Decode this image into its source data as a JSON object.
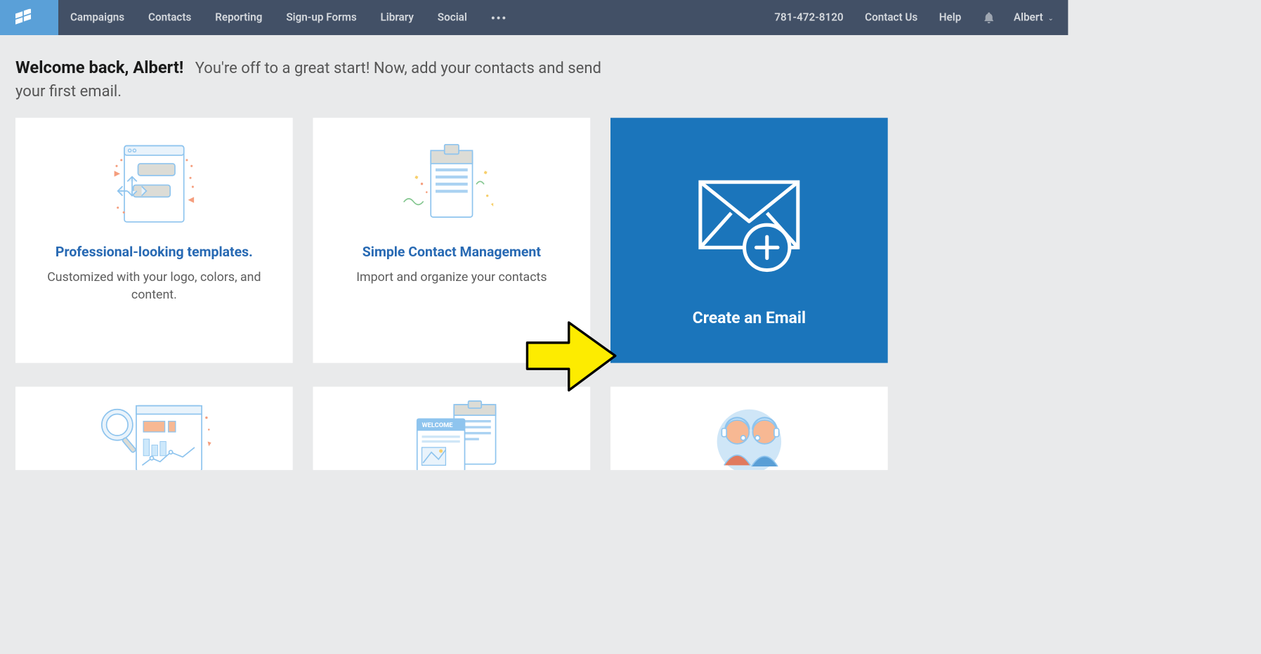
{
  "nav": {
    "items": [
      "Campaigns",
      "Contacts",
      "Reporting",
      "Sign-up Forms",
      "Library",
      "Social"
    ],
    "phone": "781-472-8120",
    "contact": "Contact Us",
    "help": "Help",
    "user": "Albert"
  },
  "welcome": {
    "strong": "Welcome back, Albert!",
    "sub": "You're off to a great start! Now, add your contacts and send your first email."
  },
  "cards": {
    "templates": {
      "title": "Professional-looking templates.",
      "desc": "Customized with your logo, colors, and content."
    },
    "contacts": {
      "title": "Simple Contact Management",
      "desc": "Import and organize your contacts"
    },
    "create": {
      "title": "Create an Email"
    },
    "row2_welcome_label": "WELCOME"
  }
}
